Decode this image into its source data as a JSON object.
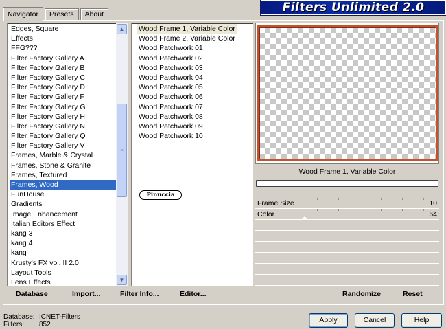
{
  "tabs": [
    "Navigator",
    "Presets",
    "About"
  ],
  "logo_text": "Filters Unlimited 2.0",
  "categories": [
    "Edges, Square",
    "Effects",
    "FFG???",
    "Filter Factory Gallery A",
    "Filter Factory Gallery B",
    "Filter Factory Gallery C",
    "Filter Factory Gallery D",
    "Filter Factory Gallery F",
    "Filter Factory Gallery G",
    "Filter Factory Gallery H",
    "Filter Factory Gallery N",
    "Filter Factory Gallery Q",
    "Filter Factory Gallery V",
    "Frames, Marble & Crystal",
    "Frames, Stone & Granite",
    "Frames, Textured",
    "Frames, Wood",
    "FunHouse",
    "Gradients",
    "Image Enhancement",
    "Italian Editors Effect",
    "kang 3",
    "kang 4",
    "kang",
    "Krusty's FX vol. II 2.0",
    "Layout Tools",
    "Lens Effects"
  ],
  "selected_category": "Frames, Wood",
  "filters": [
    "Wood Frame 1, Variable Color",
    "Wood Frame 2, Variable Color",
    "Wood Patchwork 01",
    "Wood Patchwork 02",
    "Wood Patchwork 03",
    "Wood Patchwork 04",
    "Wood Patchwork 05",
    "Wood Patchwork 06",
    "Wood Patchwork 07",
    "Wood Patchwork 08",
    "Wood Patchwork 09",
    "Wood Patchwork 10"
  ],
  "selected_filter": "Wood Frame 1, Variable Color",
  "watermark": "Pinuccia",
  "preview_filter_name": "Wood Frame 1, Variable Color",
  "params": [
    {
      "label": "Frame Size",
      "value": "10"
    },
    {
      "label": "Color",
      "value": "64"
    }
  ],
  "toolbar": {
    "database": "Database",
    "import": "Import...",
    "filter_info": "Filter Info...",
    "editor": "Editor...",
    "randomize": "Randomize",
    "reset": "Reset"
  },
  "footer": {
    "database_label": "Database:",
    "database_value": "ICNET-Filters",
    "filters_label": "Filters:",
    "filters_value": "852"
  },
  "buttons": {
    "apply": "Apply",
    "cancel": "Cancel",
    "help": "Help"
  },
  "colors": {
    "selection": "#316ac5",
    "frame": "#c2532c",
    "logo_bg": "#0a2ba6"
  }
}
